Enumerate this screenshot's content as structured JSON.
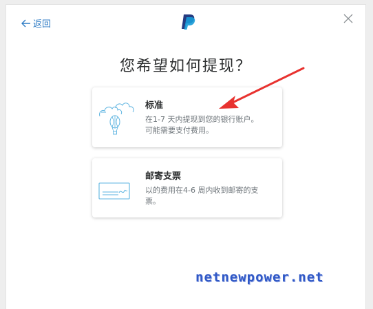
{
  "header": {
    "back_label": "返回",
    "logo_icon": "paypal-logo-icon",
    "close_icon": "close-icon"
  },
  "title": "您希望如何提现？",
  "options": [
    {
      "heading": "标准",
      "line1": "在1-7 天内提现到您的银行账户。",
      "line2": "可能需要支付费用。",
      "icon": "cloud-balloon-icon"
    },
    {
      "heading": "邮寄支票",
      "line1": "以的费用在4-6 周内收到邮寄的支",
      "line2": "票。",
      "icon": "check-icon"
    }
  ],
  "annotation": {
    "arrow_color": "#e8322f"
  },
  "watermark": "netnewpower.net",
  "colors": {
    "accent": "#2c7ac4",
    "icon_blue": "#5bb3e0",
    "paypal_dark": "#253b80",
    "paypal_light": "#179bd7"
  }
}
